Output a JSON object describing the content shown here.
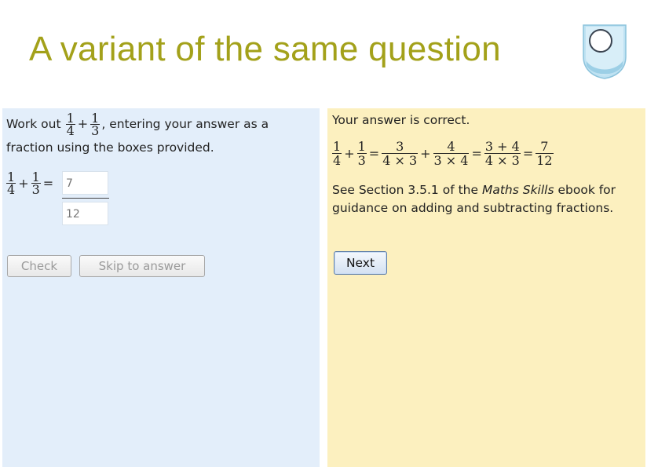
{
  "slide": {
    "title": "A variant of the same question"
  },
  "question": {
    "prefix": "Work out",
    "frac_a": {
      "num": "1",
      "den": "4"
    },
    "plus": "+",
    "frac_b": {
      "num": "1",
      "den": "3"
    },
    "suffix": ", entering your answer as a",
    "line2": "fraction using the boxes provided.",
    "equals": "="
  },
  "answer": {
    "numerator_value": "7",
    "denominator_value": "12"
  },
  "buttons": {
    "check": "Check",
    "skip": "Skip to answer",
    "next": "Next"
  },
  "feedback": {
    "status": "Your answer is correct.",
    "working": {
      "t1": {
        "num": "1",
        "den": "4"
      },
      "t2": {
        "num": "1",
        "den": "3"
      },
      "t3": {
        "num": "3",
        "den": "4 × 3"
      },
      "t4": {
        "num": "4",
        "den": "3 × 4"
      },
      "t5": {
        "num": "3 + 4",
        "den": "4 × 3"
      },
      "t6": {
        "num": "7",
        "den": "12"
      },
      "plus": "+",
      "equals": "="
    },
    "ref_before": "See Section 3.5.1 of the ",
    "ref_book": "Maths Skills",
    "ref_after": " ebook for guidance on adding and subtracting fractions."
  },
  "colors": {
    "title": "#a3a11a",
    "left_panel": "#e3eefa",
    "right_panel": "#fcf0bf"
  },
  "icons": {
    "logo": "open-university-shield-logo"
  }
}
